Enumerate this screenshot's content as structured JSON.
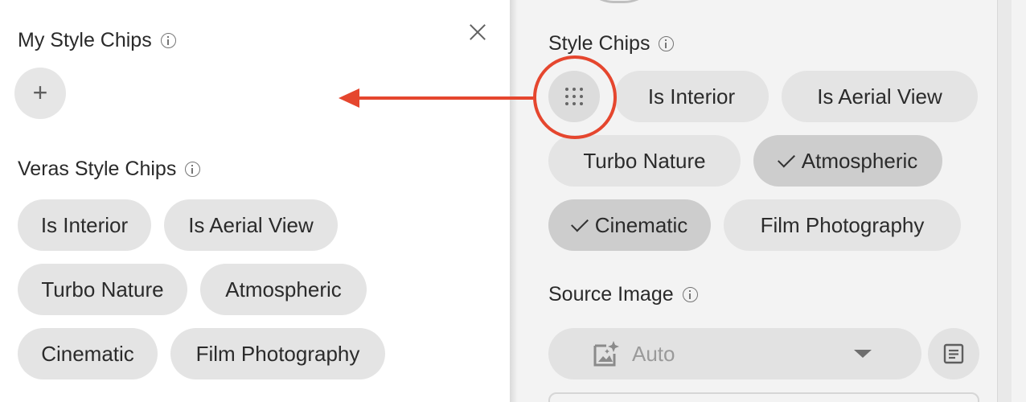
{
  "left": {
    "my_chips_title": "My Style Chips",
    "add_label": "+",
    "veras_title": "Veras Style Chips",
    "chips": [
      {
        "label": "Is Interior"
      },
      {
        "label": "Is Aerial View"
      },
      {
        "label": "Turbo Nature"
      },
      {
        "label": "Atmospheric"
      },
      {
        "label": "Cinematic"
      },
      {
        "label": "Film Photography"
      }
    ]
  },
  "right": {
    "style_chips_title": "Style Chips",
    "chips": [
      {
        "label": "Is Interior",
        "selected": false
      },
      {
        "label": "Is Aerial View",
        "selected": false
      },
      {
        "label": "Turbo Nature",
        "selected": false
      },
      {
        "label": "Atmospheric",
        "selected": true
      },
      {
        "label": "Cinematic",
        "selected": true
      },
      {
        "label": "Film Photography",
        "selected": false
      }
    ],
    "source_image_title": "Source Image",
    "source_select_value": "Auto"
  },
  "icons": {
    "info": "info-icon",
    "close": "close-icon",
    "add": "plus-icon",
    "grid": "grid-dots-icon",
    "auto": "image-sparkle-icon",
    "caret": "caret-down-icon",
    "doc": "document-list-icon",
    "check": "check-icon"
  },
  "colors": {
    "highlight": "#e5462e",
    "chip_bg": "#e4e4e4",
    "chip_selected_bg": "#cdcdcd",
    "right_panel_bg": "#f3f3f3"
  }
}
